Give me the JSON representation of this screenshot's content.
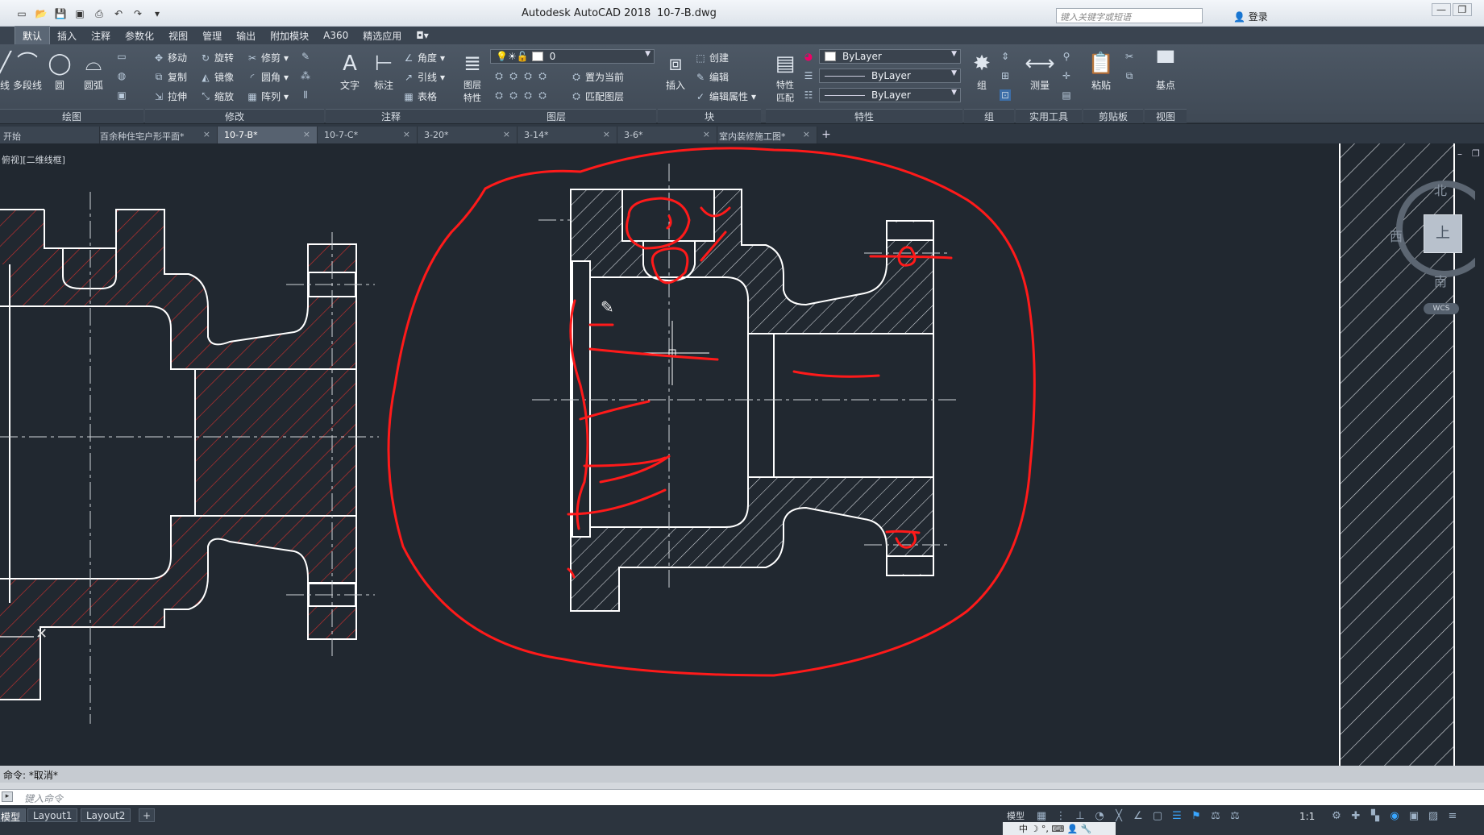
{
  "app": {
    "title": "Autodesk AutoCAD 2018",
    "file": "10-7-B.dwg",
    "search_placeholder": "键入关键字或短语",
    "signin": "登录"
  },
  "ribbon_tabs": [
    "默认",
    "插入",
    "注释",
    "参数化",
    "视图",
    "管理",
    "输出",
    "附加模块",
    "A360",
    "精选应用"
  ],
  "ribbon": {
    "draw": {
      "label": "绘图",
      "polyline": "多段线",
      "circle": "圆",
      "arc": "圆弧",
      "line_partial": "线"
    },
    "modify": {
      "label": "修改",
      "move": "移动",
      "rotate": "旋转",
      "trim": "修剪",
      "copy": "复制",
      "mirror": "镜像",
      "fillet": "圆角",
      "stretch": "拉伸",
      "scale": "缩放",
      "array": "阵列"
    },
    "annotation": {
      "label": "注释",
      "text": "文字",
      "dimension": "标注",
      "angle": "角度",
      "leader": "引线",
      "table": "表格"
    },
    "layers": {
      "label": "图层",
      "layer_props_1": "图层",
      "layer_props_2": "特性",
      "current_layer": "0",
      "set_current": "置为当前",
      "match_layer": "匹配图层"
    },
    "block": {
      "label": "块",
      "insert": "插入",
      "create": "创建",
      "edit": "编辑",
      "edit_attr": "编辑属性"
    },
    "properties": {
      "label": "特性",
      "match_1": "特性",
      "match_2": "匹配",
      "color": "ByLayer",
      "linetype": "ByLayer",
      "lineweight": "ByLayer"
    },
    "groups": {
      "label": "组",
      "group": "组"
    },
    "utilities": {
      "label": "实用工具",
      "measure": "测量"
    },
    "clipboard": {
      "label": "剪贴板",
      "paste": "粘贴"
    },
    "view": {
      "label": "视图",
      "base": "基点"
    }
  },
  "doc_tabs": [
    "开始",
    "百余种住宅户形平面*",
    "10-7-B*",
    "10-7-C*",
    "3-20*",
    "3-14*",
    "3-6*",
    "室内装修施工图*"
  ],
  "viewport_label": "俯视][二维线框]",
  "viewcube": {
    "north": "北",
    "west": "西",
    "south": "南",
    "top": "上",
    "wcs": "WCS"
  },
  "command": {
    "history": "命令: *取消*",
    "prompt": "键入命令"
  },
  "layout_tabs": [
    "模型",
    "Layout1",
    "Layout2"
  ],
  "status": {
    "model": "模型",
    "scale": "1:1",
    "ime": "中"
  }
}
